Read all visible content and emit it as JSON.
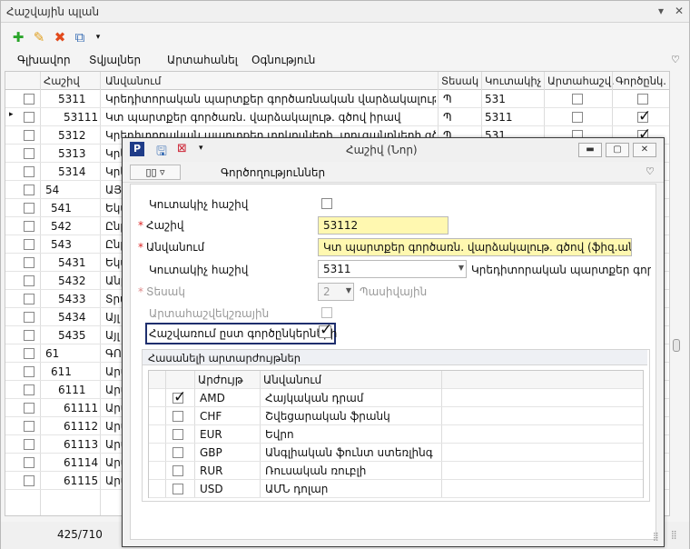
{
  "window": {
    "title": "Հաշվային պլան"
  },
  "menu": [
    "Գլխավոր",
    "Տվյալներ",
    "Արտահանել",
    "Օգնություն"
  ],
  "grid": {
    "columns": [
      "Հաշիվ",
      "Անվանում",
      "Տեսակ",
      "Կուտակիչ",
      "Արտահաշվ.",
      "Գործընկ."
    ],
    "rows": [
      {
        "code": "5311",
        "name": "Կրեդիտորական պարտքեր գործառնական վարձակալութ. գծով",
        "type": "Պ",
        "acc": "531",
        "off": false,
        "partner": false
      },
      {
        "code": "53111",
        "name": "Կտ պարտքեր գործառն. վարձակալութ. գծով իրավ",
        "type": "Պ",
        "acc": "5311",
        "off": false,
        "partner": true
      },
      {
        "code": "5312",
        "name": "Կրեդիտորական պարտքեր տոկոսների, տուգանքների գծով",
        "type": "Պ",
        "acc": "531",
        "off": false,
        "partner": true
      },
      {
        "code": "5313",
        "name": "Կրե",
        "type": "",
        "acc": "",
        "off": false,
        "partner": false
      },
      {
        "code": "5314",
        "name": "Կրե",
        "type": "",
        "acc": "",
        "off": false,
        "partner": false
      },
      {
        "code": "54",
        "name": "ԱՅԼ",
        "type": "",
        "acc": "",
        "off": false,
        "partner": false
      },
      {
        "code": "541",
        "name": "Եկա",
        "type": "",
        "acc": "",
        "off": false,
        "partner": false
      },
      {
        "code": "542",
        "name": "Ընթ",
        "type": "",
        "acc": "",
        "off": false,
        "partner": false
      },
      {
        "code": "543",
        "name": "Ընթ",
        "type": "",
        "acc": "",
        "off": false,
        "partner": false
      },
      {
        "code": "5431",
        "name": "Եկա",
        "type": "",
        "acc": "",
        "off": false,
        "partner": false
      },
      {
        "code": "5432",
        "name": "Անը",
        "type": "",
        "acc": "",
        "off": false,
        "partner": false
      },
      {
        "code": "5433",
        "name": "Տրա",
        "type": "",
        "acc": "",
        "off": false,
        "partner": false
      },
      {
        "code": "5434",
        "name": "Այլ ",
        "type": "",
        "acc": "",
        "off": false,
        "partner": false
      },
      {
        "code": "5435",
        "name": "Այլ ",
        "type": "",
        "acc": "",
        "off": false,
        "partner": false
      },
      {
        "code": "61",
        "name": "ԳՈՐ",
        "type": "",
        "acc": "",
        "off": false,
        "partner": false
      },
      {
        "code": "611",
        "name": "Արտ",
        "type": "",
        "acc": "",
        "off": false,
        "partner": false
      },
      {
        "code": "6111",
        "name": "Արտ",
        "type": "",
        "acc": "",
        "off": false,
        "partner": false
      },
      {
        "code": "61111",
        "name": "Արտ",
        "type": "",
        "acc": "",
        "off": false,
        "partner": false
      },
      {
        "code": "61112",
        "name": "Արտ",
        "type": "",
        "acc": "",
        "off": false,
        "partner": false
      },
      {
        "code": "61113",
        "name": "Արտ",
        "type": "",
        "acc": "",
        "off": false,
        "partner": false
      },
      {
        "code": "61114",
        "name": "Արտ",
        "type": "",
        "acc": "",
        "off": false,
        "partner": false
      },
      {
        "code": "61115",
        "name": "Արտ",
        "type": "",
        "acc": "",
        "off": false,
        "partner": false
      }
    ]
  },
  "status": {
    "count": "425/710"
  },
  "dialog": {
    "title": "Հաշիվ (Նոր)",
    "menu_label": "Գործողություններ",
    "accumulator_label": "Կուտակիչ հաշիվ",
    "account_label": "Հաշիվ",
    "account_value": "53112",
    "name_label": "Անվանում",
    "name_value": "Կտ պարտքեր գործառն. վարձակալութ. գծով (ֆիզ.անձինք)",
    "parent_label": "Կուտակիչ հաշիվ",
    "parent_value": "5311",
    "parent_desc": "Կրեդիտորական պարտքեր գործա",
    "type_label": "Տեսակ",
    "type_value": "2",
    "type_desc": "Պասիվային",
    "offbalance_label": "Արտահաշվեկշռային",
    "partner_label": "Հաշվառում ըստ գործընկերների",
    "group_title": "Հասանելի արտարժույթներ",
    "cur_columns": [
      "Արժույթ",
      "Անվանում"
    ],
    "currencies": [
      {
        "code": "AMD",
        "name": "Հայկական դրամ",
        "checked": true
      },
      {
        "code": "CHF",
        "name": "Շվեցարական ֆրանկ",
        "checked": false
      },
      {
        "code": "EUR",
        "name": "Եվրո",
        "checked": false
      },
      {
        "code": "GBP",
        "name": "Անգլիական ֆունտ ստեռլինգ",
        "checked": false
      },
      {
        "code": "RUR",
        "name": "Ռուսական ռուբլի",
        "checked": false
      },
      {
        "code": "USD",
        "name": "ԱՄՆ դոլար",
        "checked": false
      }
    ]
  }
}
